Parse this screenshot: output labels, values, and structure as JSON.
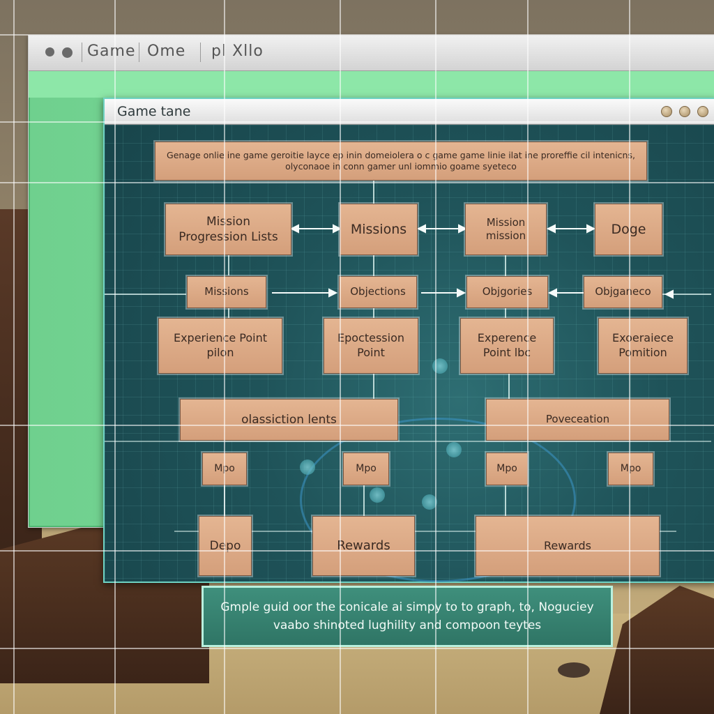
{
  "back_window": {
    "title_1": "Game",
    "title_2": "Ome",
    "title_3": "pl Xllo"
  },
  "front_window": {
    "title": "Game tane"
  },
  "diagram": {
    "header": "Genage onlie ine game geroitie layce ep inin domeiolera o c game game linie ilat ine proreffie cil intenicns, olyconaoe in conn gamer unl iommio goame syeteco",
    "row1": [
      "Mission Progression Lists",
      "Missions",
      "Mission mission",
      "Doge"
    ],
    "row2": [
      "Missions",
      "Objections",
      "Objgories",
      "Objganeco"
    ],
    "row3": [
      "Experience Point pilon",
      "Epoctession Point",
      "Experence Point lbc",
      "Exoeraiece Pomition"
    ],
    "row4": [
      "olassiction lents",
      "Poveceation"
    ],
    "row5": [
      "Mpo",
      "Mpo",
      "Mpo",
      "Mpo"
    ],
    "row6": [
      "Depo",
      "Rewards",
      "Rewards"
    ]
  },
  "caption": "Gmple guid oor the conicale ai simpy to to graph, to, Noguciey vaabo shinoted lughility and compoon teytes",
  "colors": {
    "box_fill": "#d9a582",
    "panel_bg": "#1f5359",
    "accent_green": "#7fdc9c",
    "caption_bg": "#357f6d"
  }
}
